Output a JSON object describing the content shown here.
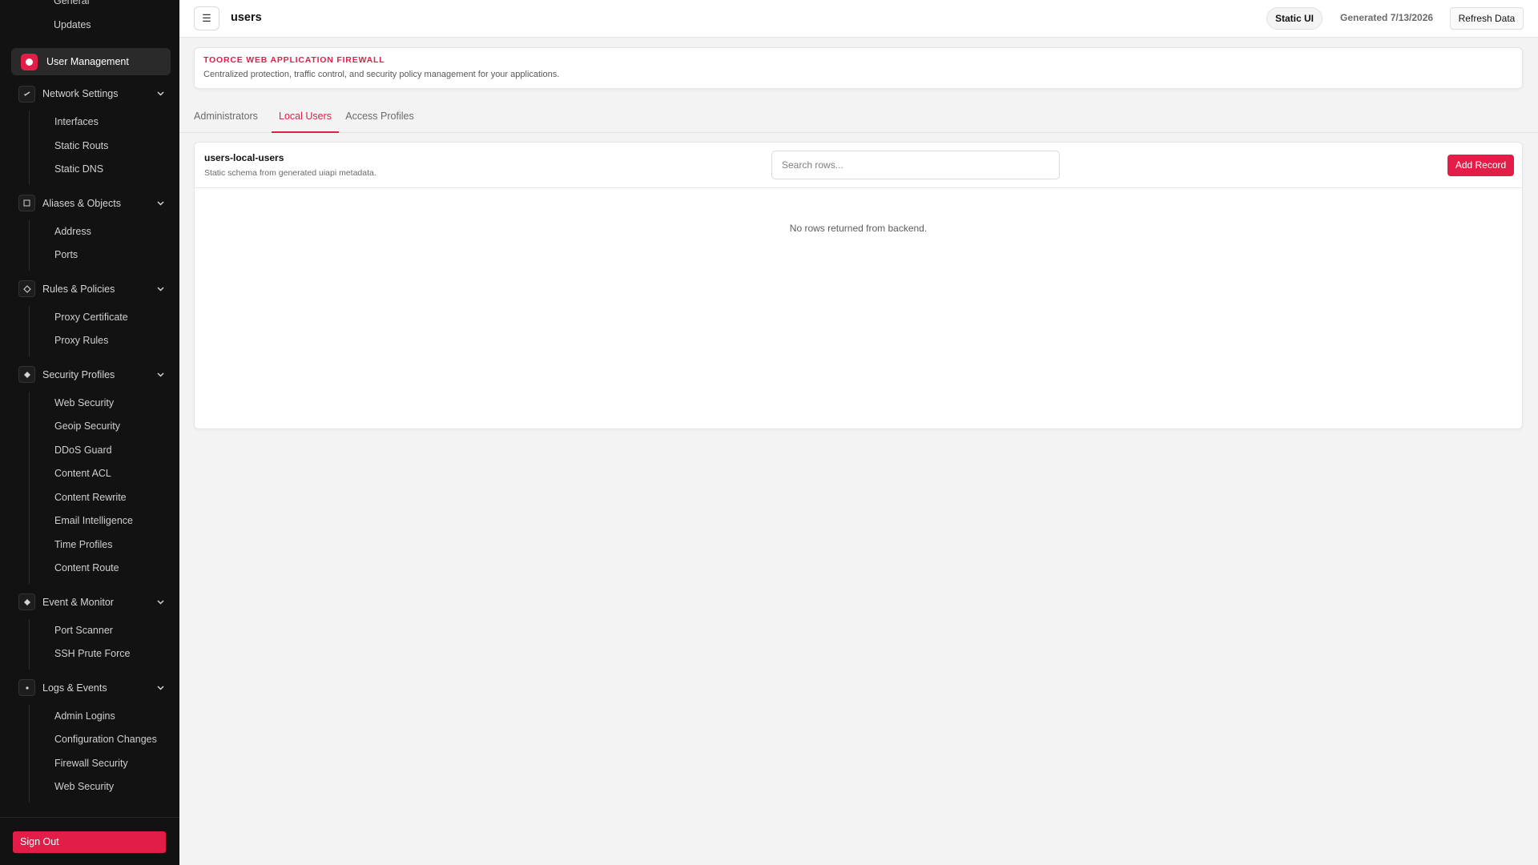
{
  "sidebar": {
    "top_items": [
      "General",
      "Updates"
    ],
    "active_item": {
      "label": "User Management"
    },
    "groups": [
      {
        "label": "Network Settings",
        "icon": "link-icon",
        "items": [
          "Interfaces",
          "Static Routs",
          "Static DNS"
        ]
      },
      {
        "label": "Aliases & Objects",
        "icon": "square-icon",
        "items": [
          "Address",
          "Ports"
        ]
      },
      {
        "label": "Rules & Policies",
        "icon": "diamond-outline-icon",
        "items": [
          "Proxy Certificate",
          "Proxy Rules"
        ]
      },
      {
        "label": "Security Profiles",
        "icon": "diamond-filled-icon",
        "items": [
          "Web Security",
          "Geoip Security",
          "DDoS Guard",
          "Content ACL",
          "Content Rewrite",
          "Email Intelligence",
          "Time Profiles",
          "Content Route"
        ]
      },
      {
        "label": "Event & Monitor",
        "icon": "diamond-filled-icon",
        "items": [
          "Port Scanner",
          "SSH Prute Force"
        ]
      },
      {
        "label": "Logs & Events",
        "icon": "dot-icon",
        "items": [
          "Admin Logins",
          "Configuration Changes",
          "Firewall Security",
          "Web Security"
        ]
      }
    ],
    "signout_label": "Sign Out"
  },
  "topbar": {
    "menu_glyph": "☰",
    "title": "users",
    "badge": "Static UI",
    "generated": "Generated 7/13/2026",
    "refresh_label": "Refresh Data"
  },
  "banner": {
    "title": "TOORCE WEB APPLICATION FIREWALL",
    "subtitle": "Centralized protection, traffic control, and security policy management for your applications."
  },
  "tabs": [
    {
      "label": "Administrators",
      "active": false
    },
    {
      "label": "Local Users",
      "active": true
    },
    {
      "label": "Access Profiles",
      "active": false
    }
  ],
  "table": {
    "title": "users-local-users",
    "subtitle": "Static schema from generated uiapi metadata.",
    "search_placeholder": "Search rows...",
    "search_value": "",
    "add_label": "Add Record",
    "empty_message": "No rows returned from backend."
  },
  "colors": {
    "accent": "#e11d48",
    "sidebar_bg": "#121212",
    "page_bg": "#f3f3f3"
  }
}
